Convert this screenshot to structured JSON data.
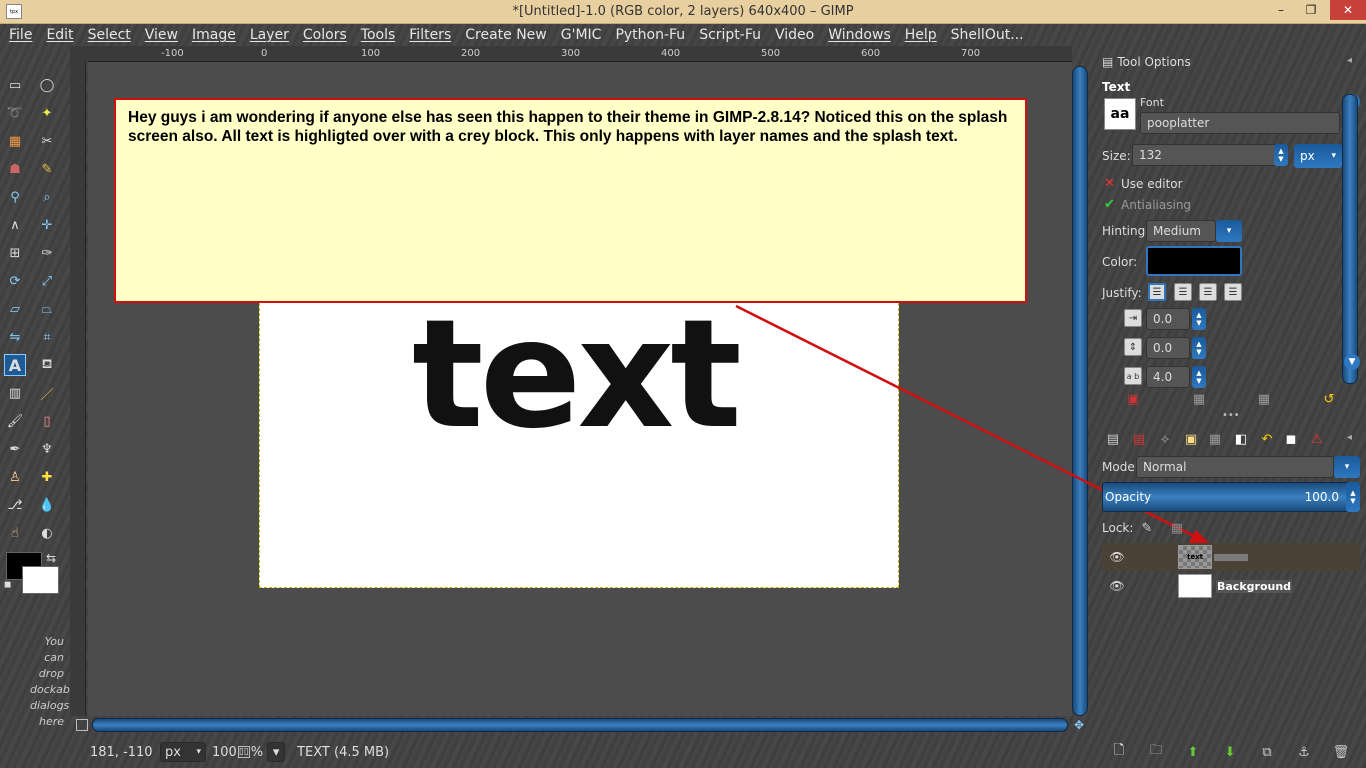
{
  "titlebar": {
    "title": "*[Untitled]-1.0 (RGB color, 2 layers) 640x400 – GIMP",
    "minimize": "–",
    "maximize": "❐",
    "close": "✕"
  },
  "menubar": {
    "items": [
      "File",
      "Edit",
      "Select",
      "View",
      "Image",
      "Layer",
      "Colors",
      "Tools",
      "Filters",
      "Create New",
      "G'MIC",
      "Python-Fu",
      "Script-Fu",
      "Video",
      "Windows",
      "Help",
      "ShellOut..."
    ]
  },
  "ruler": {
    "ticks": [
      "-100",
      "0",
      "100",
      "200",
      "300",
      "400",
      "500",
      "600",
      "700"
    ]
  },
  "canvas": {
    "text": "text"
  },
  "toolbox": {
    "drop_hint": "You can drop dockable dialogs here"
  },
  "statusbar": {
    "coords": "181, -110",
    "unit": "px",
    "zoom": "100",
    "zoom_suffix": "%",
    "info": "TEXT (4.5 MB)"
  },
  "callout": {
    "text": "Hey guys i am wondering if anyone else has seen this happen to their theme in GIMP-2.8.14? Noticed this on the splash screen also. All text is highligted over with a crey block. This only happens with layer names and the splash text."
  },
  "tool_options": {
    "tab_label": "Tool Options",
    "section": "Text",
    "font_label": "Font",
    "font_value": "pooplatter",
    "size_label": "Size:",
    "size_value": "132",
    "size_unit": "px",
    "use_editor": "Use editor",
    "antialiasing": "Antialiasing",
    "hinting_label": "Hinting:",
    "hinting_value": "Medium",
    "color_label": "Color:",
    "justify_label": "Justify:",
    "indent": "0.0",
    "line_spacing": "0.0",
    "letter_spacing": "4.0",
    "color": "#000000"
  },
  "layers": {
    "mode_label": "Mode:",
    "mode_value": "Normal",
    "opacity_label": "Opacity",
    "opacity_value": "100.0",
    "lock_label": "Lock:",
    "items": [
      {
        "name": "",
        "thumb_label": "text"
      },
      {
        "name": "Background"
      }
    ]
  },
  "colors": {
    "accent": "#2e78c0",
    "titlebar": "#e8cfa0",
    "callout_bg": "#ffffc7",
    "callout_border": "#d01010"
  }
}
